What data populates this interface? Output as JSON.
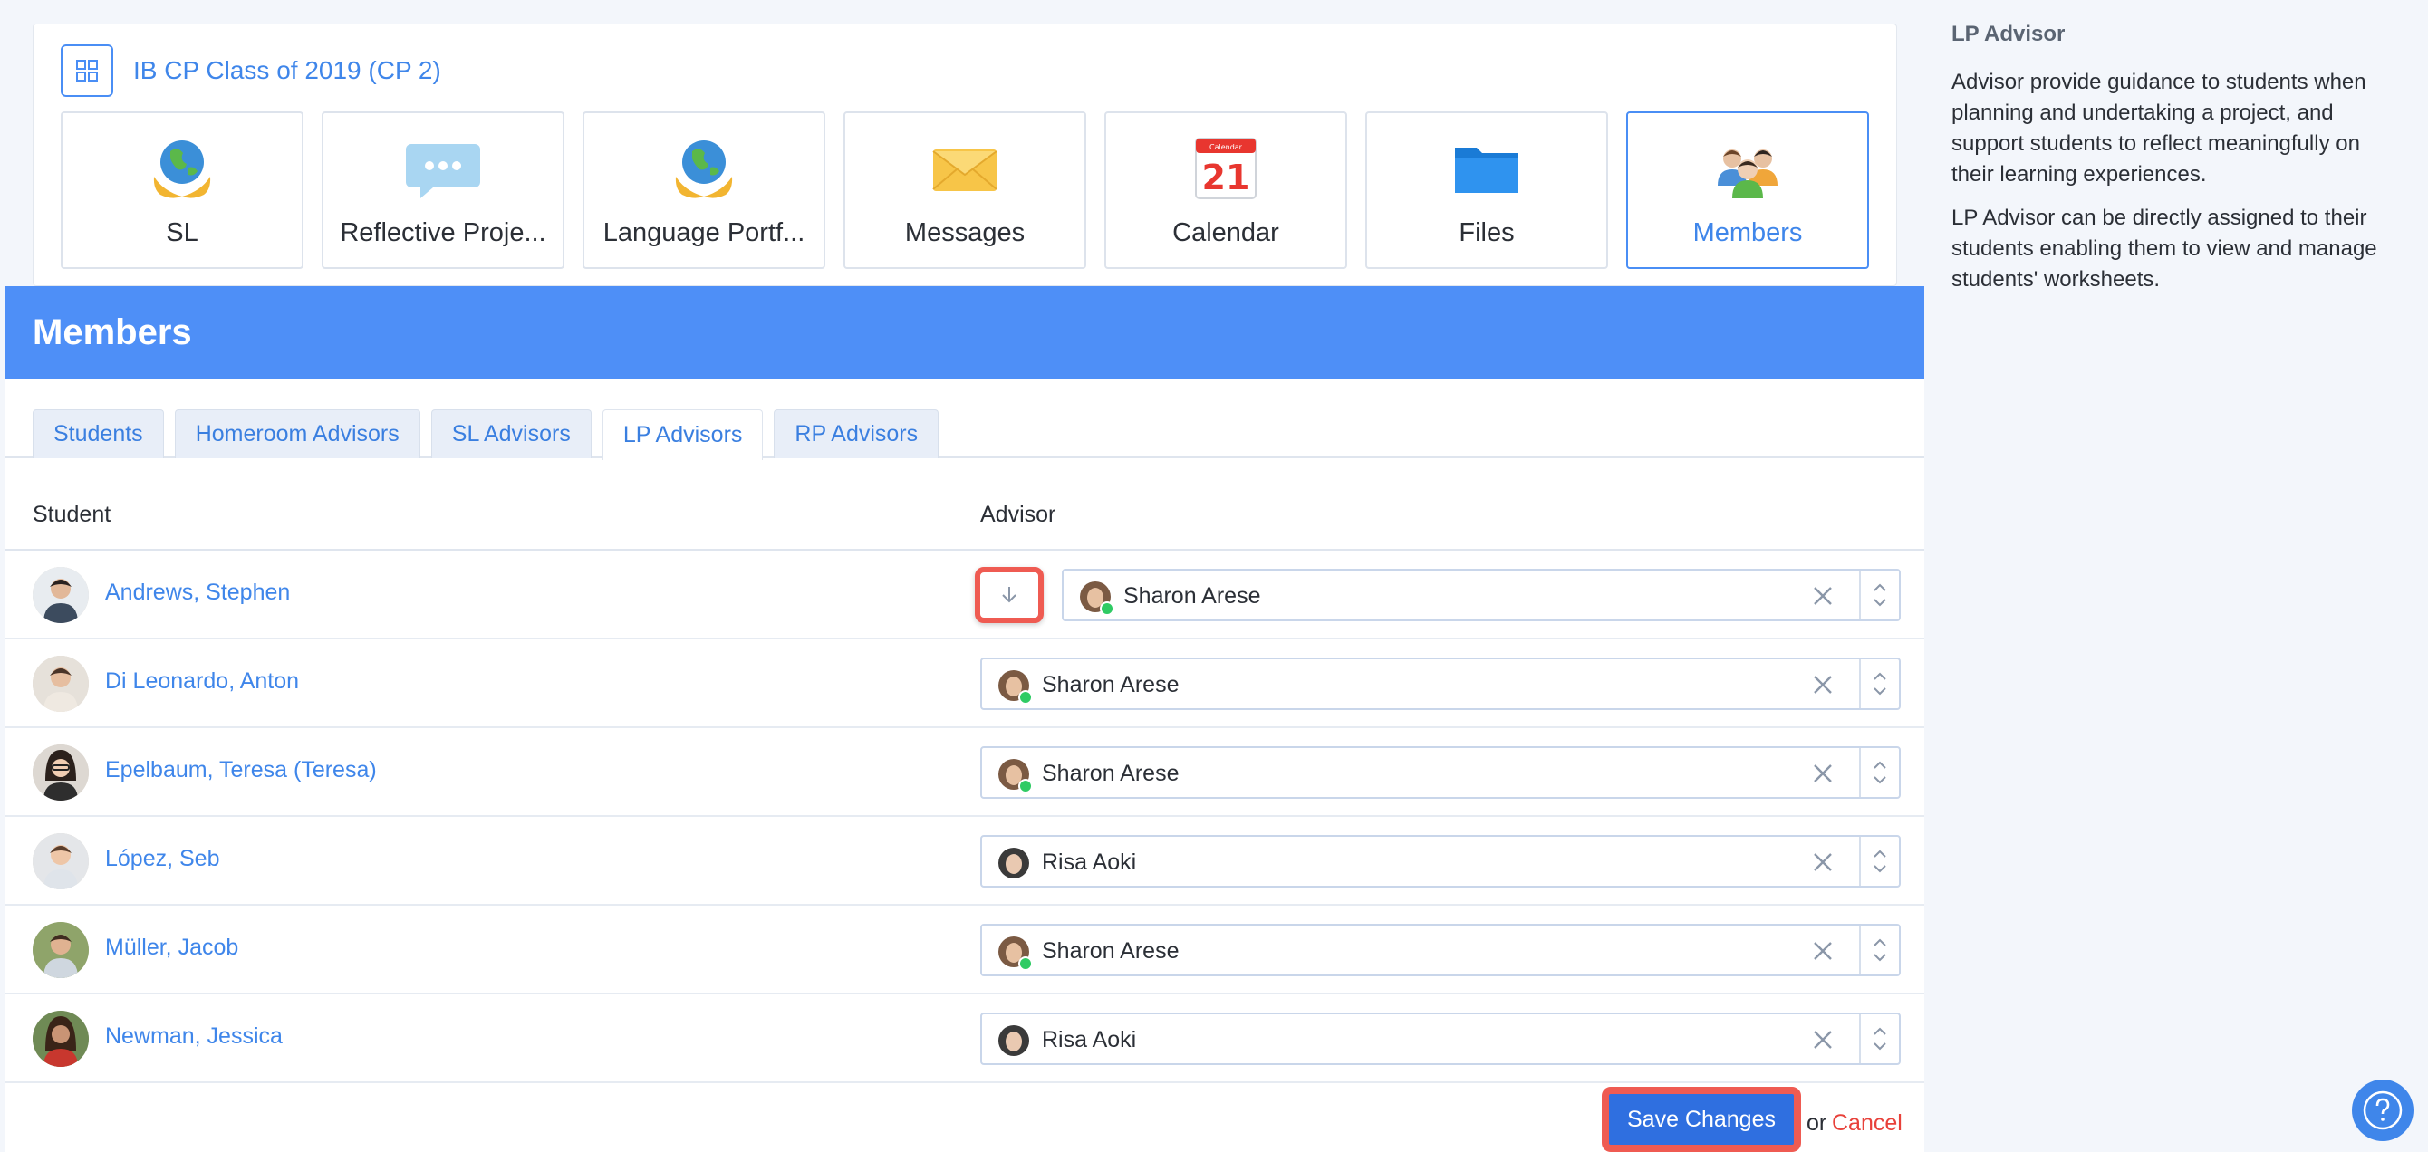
{
  "class": {
    "title": "IB CP Class of 2019 (CP 2)",
    "tiles": [
      {
        "label": "SL",
        "icon": "globe-hands-icon"
      },
      {
        "label": "Reflective Proje...",
        "icon": "speech-bubble-icon"
      },
      {
        "label": "Language Portf...",
        "icon": "globe-hands-icon"
      },
      {
        "label": "Messages",
        "icon": "envelope-icon"
      },
      {
        "label": "Calendar",
        "icon": "calendar-icon",
        "calendar_header": "Calendar",
        "calendar_day": "21"
      },
      {
        "label": "Files",
        "icon": "folder-icon"
      },
      {
        "label": "Members",
        "icon": "people-group-icon",
        "active": true
      }
    ]
  },
  "members": {
    "title": "Members",
    "tabs": [
      {
        "label": "Students"
      },
      {
        "label": "Homeroom Advisors"
      },
      {
        "label": "SL Advisors"
      },
      {
        "label": "LP Advisors",
        "active": true
      },
      {
        "label": "RP Advisors"
      }
    ],
    "columns": {
      "student": "Student",
      "advisor": "Advisor"
    },
    "rows": [
      {
        "student": "Andrews, Stephen",
        "advisor": "Sharon Arese",
        "online": true
      },
      {
        "student": "Di Leonardo, Anton",
        "advisor": "Sharon Arese",
        "online": true
      },
      {
        "student": "Epelbaum, Teresa (Teresa)",
        "advisor": "Sharon Arese",
        "online": true
      },
      {
        "student": "López, Seb",
        "advisor": "Risa Aoki",
        "online": false
      },
      {
        "student": "Müller, Jacob",
        "advisor": "Sharon Arese",
        "online": true
      },
      {
        "student": "Newman, Jessica",
        "advisor": "Risa Aoki",
        "online": false
      }
    ],
    "save_label": "Save Changes",
    "or_label": "or",
    "cancel_label": "Cancel"
  },
  "info": {
    "title": "LP Advisor",
    "paragraph_1": "Advisor provide guidance to students when planning and undertaking a project, and support students to reflect meaningfully on their learning experiences.",
    "paragraph_2": "LP Advisor can be directly assigned to their students enabling them to view and manage students' worksheets."
  },
  "colors": {
    "accent": "#4e8ff7",
    "link": "#3f86ea",
    "highlight": "#ef5b52",
    "cancel": "#e8413a",
    "online": "#2fcb64"
  }
}
